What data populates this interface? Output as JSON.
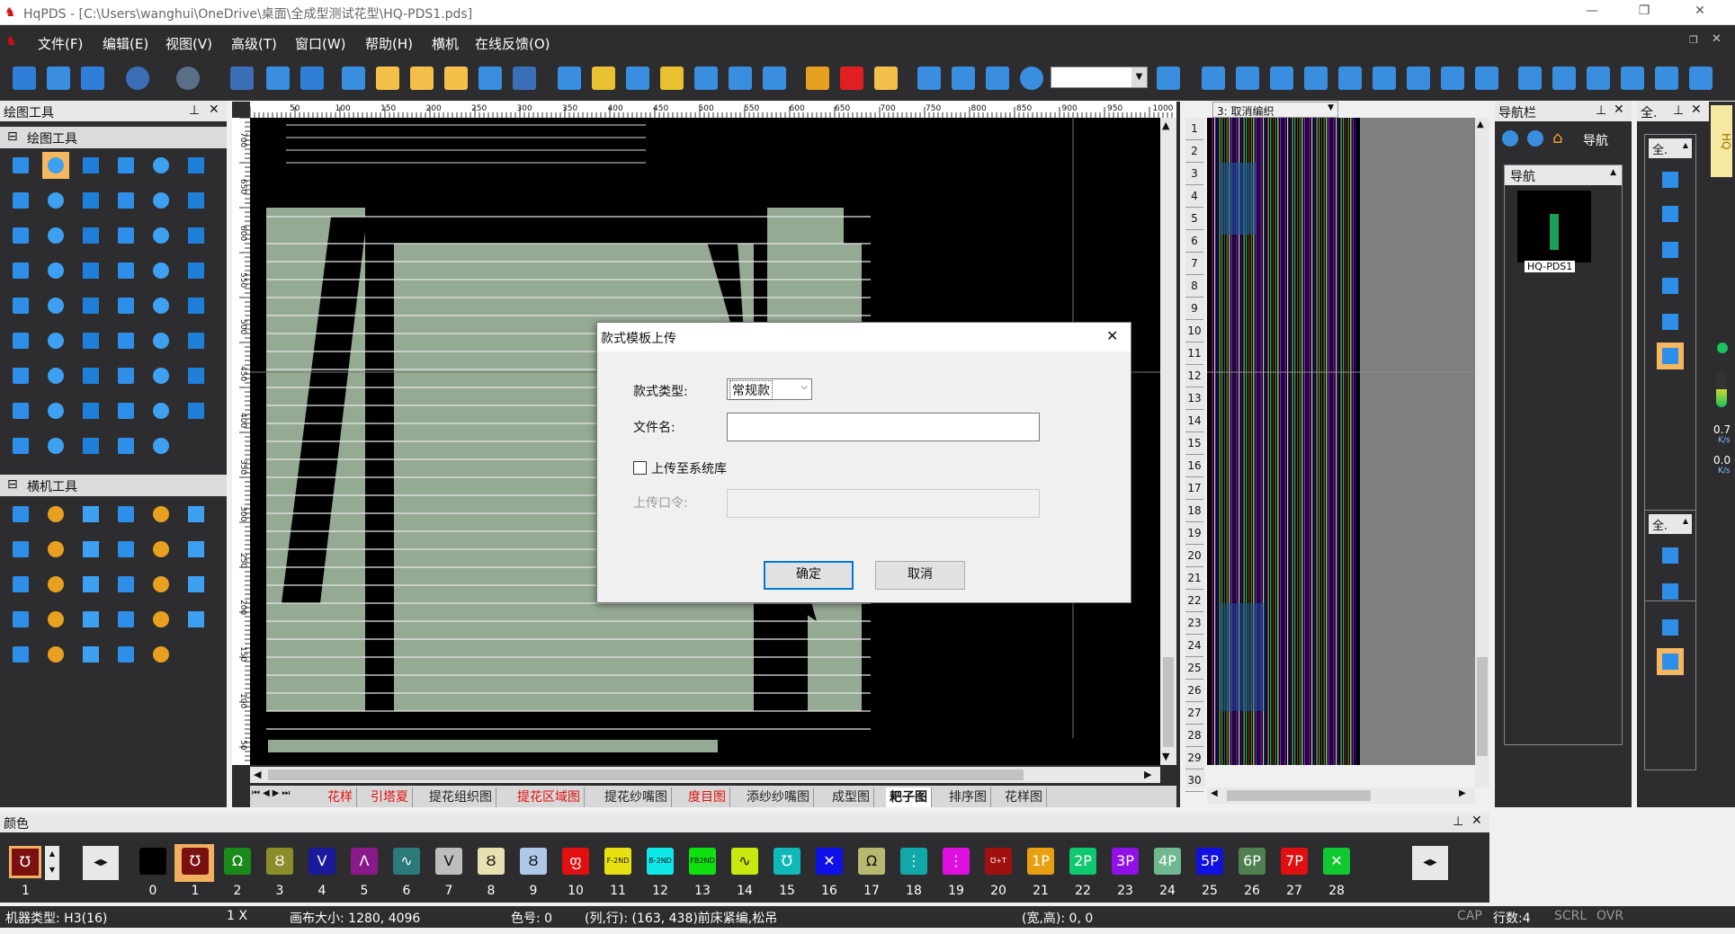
{
  "window": {
    "title": "HqPDS - [C:\\Users\\wanghui\\OneDrive\\桌面\\全成型测试花型\\HQ-PDS1.pds]"
  },
  "menu": [
    "文件(F)",
    "编辑(E)",
    "视图(V)",
    "高级(T)",
    "窗口(W)",
    "帮助(H)",
    "横机",
    "在线反馈(O)"
  ],
  "panels": {
    "drawing_tools": "绘图工具",
    "drawing_section": "绘图工具",
    "knitting_section": "横机工具",
    "navigator": "导航栏",
    "nav_label": "导航",
    "nav_header": "导航",
    "nav_thumb": "HQ-PDS1",
    "right_dock": "全.",
    "right_btn1": "全.",
    "right_btn2": "全.",
    "undo_label": "3: 取消编织",
    "colors": "颜色",
    "side_tab": "HQ"
  },
  "ruler_top": [
    "50",
    "100",
    "150",
    "200",
    "250",
    "300",
    "350",
    "400",
    "450",
    "500",
    "550",
    "600",
    "650",
    "700",
    "750",
    "800",
    "850",
    "900",
    "950",
    "1000"
  ],
  "ruler_left": [
    "700",
    "650",
    "600",
    "550",
    "500",
    "450",
    "400",
    "350",
    "300",
    "250",
    "200",
    "150",
    "100",
    "50"
  ],
  "row_numbers": [
    "1",
    "2",
    "3",
    "4",
    "5",
    "6",
    "7",
    "8",
    "9",
    "10",
    "11",
    "12",
    "13",
    "14",
    "15",
    "16",
    "17",
    "18",
    "19",
    "20",
    "21",
    "22",
    "23",
    "24",
    "25",
    "26",
    "27",
    "28",
    "29",
    "30"
  ],
  "tabs": [
    {
      "label": "花样",
      "color": "#e01010",
      "active": false
    },
    {
      "label": "引塔夏",
      "color": "#e01010",
      "active": false
    },
    {
      "label": "提花组织图",
      "color": "#222",
      "active": false
    },
    {
      "label": "提花区域图",
      "color": "#e01010",
      "active": false
    },
    {
      "label": "提花纱嘴图",
      "color": "#222",
      "active": false
    },
    {
      "label": "度目图",
      "color": "#e01010",
      "active": false
    },
    {
      "label": "添纱纱嘴图",
      "color": "#222",
      "active": false
    },
    {
      "label": "成型图",
      "color": "#222",
      "active": false
    },
    {
      "label": "耙子图",
      "color": "#111",
      "active": true
    },
    {
      "label": "排序图",
      "color": "#222",
      "active": false
    },
    {
      "label": "花样图",
      "color": "#222",
      "active": false
    }
  ],
  "dialog": {
    "title": "款式模板上传",
    "type_label": "款式类型:",
    "type_value": "常规款",
    "filename_label": "文件名:",
    "filename_value": "",
    "upload_checkbox": "上传至系统库",
    "password_label": "上传口令:",
    "ok": "确定",
    "cancel": "取消"
  },
  "swatches": [
    {
      "n": "0",
      "color": "#000000",
      "sym": ""
    },
    {
      "n": "1",
      "color": "#7a1010",
      "sym": "℧"
    },
    {
      "n": "2",
      "color": "#1a8a1a",
      "sym": "Ω"
    },
    {
      "n": "3",
      "color": "#8c8c2a",
      "sym": "Ȣ"
    },
    {
      "n": "4",
      "color": "#1a1a9a",
      "sym": "V"
    },
    {
      "n": "5",
      "color": "#8a1a8a",
      "sym": "Λ"
    },
    {
      "n": "6",
      "color": "#2a7a7a",
      "sym": "∿"
    },
    {
      "n": "7",
      "color": "#bdbdbd",
      "sym": "V"
    },
    {
      "n": "8",
      "color": "#e8e0b0",
      "sym": "Ȣ"
    },
    {
      "n": "9",
      "color": "#b0c8e8",
      "sym": "Ȣ"
    },
    {
      "n": "10",
      "color": "#e01010",
      "sym": "ფ"
    },
    {
      "n": "11",
      "color": "#e8e010",
      "sym": "F-2ND"
    },
    {
      "n": "12",
      "color": "#10e8e8",
      "sym": "B-2ND"
    },
    {
      "n": "13",
      "color": "#10e010",
      "sym": "FB2ND"
    },
    {
      "n": "14",
      "color": "#c8e810",
      "sym": "∿"
    },
    {
      "n": "15",
      "color": "#10b8b8",
      "sym": "℧"
    },
    {
      "n": "16",
      "color": "#1010e8",
      "sym": "✕"
    },
    {
      "n": "17",
      "color": "#b8b870",
      "sym": "Ω"
    },
    {
      "n": "18",
      "color": "#10a8a8",
      "sym": "⋮"
    },
    {
      "n": "19",
      "color": "#e010e0",
      "sym": "⋮"
    },
    {
      "n": "20",
      "color": "#a01010",
      "sym": "℧+T"
    },
    {
      "n": "21",
      "color": "#e8a010",
      "sym": "1P"
    },
    {
      "n": "22",
      "color": "#10c870",
      "sym": "2P"
    },
    {
      "n": "23",
      "color": "#9010e8",
      "sym": "3P"
    },
    {
      "n": "24",
      "color": "#70b890",
      "sym": "4P"
    },
    {
      "n": "25",
      "color": "#1010e0",
      "sym": "5P"
    },
    {
      "n": "26",
      "color": "#508050",
      "sym": "6P"
    },
    {
      "n": "27",
      "color": "#e01010",
      "sym": "7P"
    },
    {
      "n": "28",
      "color": "#10c830",
      "sym": "✕"
    }
  ],
  "current_color": {
    "n": "1",
    "sym": "℧"
  },
  "status": {
    "machine": "机器类型: H3(16)",
    "zoom": "1 X",
    "canvas": "画布大小: 1280, 4096",
    "color_no": "色号: 0",
    "position": "(列,行): (163, 438)前床紧编,松吊",
    "size": "(宽,高): 0, 0",
    "cap": "CAP",
    "rows": "行数:4",
    "scrl": "SCRL",
    "ovr": "OVR"
  },
  "speed": {
    "up": "0.7",
    "down": "0.0",
    "unit": "K/s"
  },
  "colors_theme": {
    "bg": "#2d2d30",
    "canvas_fill": "#95aa93",
    "dialog_bg": "#f0f0f0"
  }
}
